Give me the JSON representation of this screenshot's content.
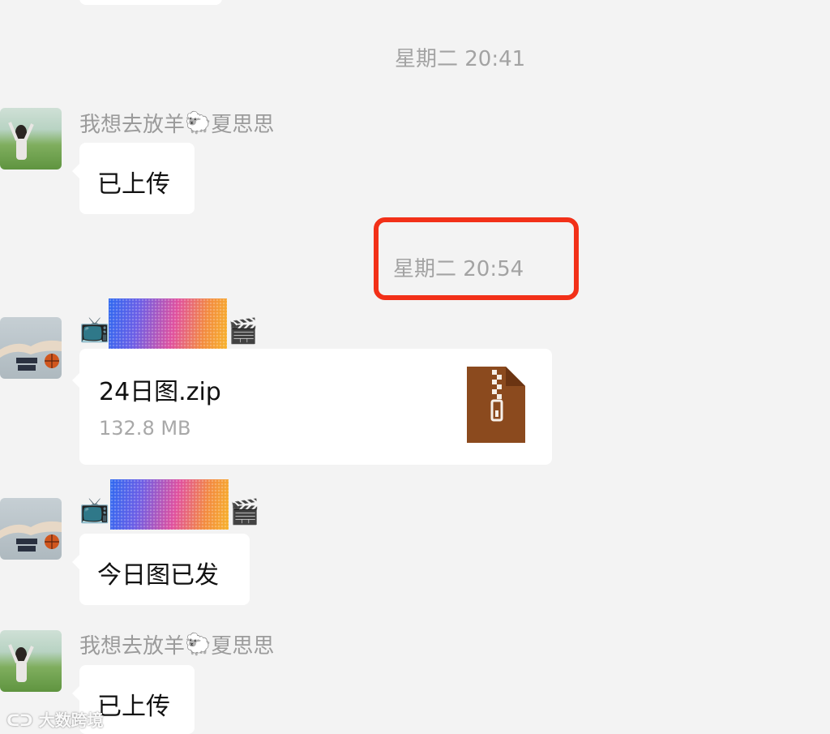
{
  "messages": {
    "time_1": "星期二 20:41",
    "msg1": {
      "sender": "我想去放羊",
      "sender_emoji": "🐑",
      "sender_suffix": "夏思思",
      "text": "已上传"
    },
    "time_2": "星期二 20:54",
    "msg2": {
      "sender_prefix_emoji": "📺",
      "sender_suffix_emoji": "🎬",
      "file": {
        "name": "24日图.zip",
        "size": "132.8 MB",
        "icon": "zip-file-icon"
      }
    },
    "msg3": {
      "sender_prefix_emoji": "📺",
      "sender_suffix_emoji": "🎬",
      "text": "今日图已发"
    },
    "msg4": {
      "sender": "我想去放羊",
      "sender_emoji": "🐑",
      "sender_suffix": "夏思思",
      "text": "已上传"
    }
  },
  "watermark": {
    "text": "大数跨境"
  },
  "colors": {
    "background": "#f3f3f3",
    "bubble": "#ffffff",
    "highlight": "#f23018",
    "zip_icon": "#8b4a1e"
  }
}
